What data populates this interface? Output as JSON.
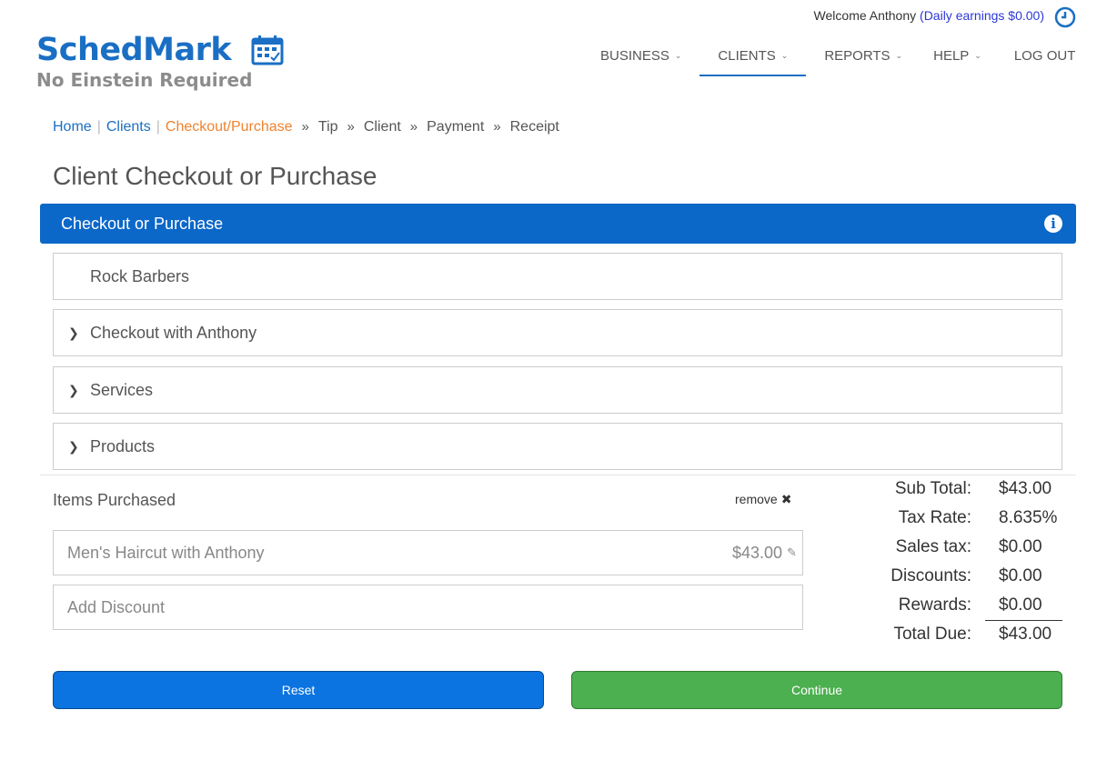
{
  "header": {
    "welcome_text": "Welcome Anthony",
    "earnings_text": "(Daily earnings $0.00)",
    "logo_title": "SchedMark",
    "logo_tagline": "No Einstein Required"
  },
  "nav": {
    "items": [
      {
        "label": "BUSINESS",
        "has_dropdown": true
      },
      {
        "label": "CLIENTS",
        "has_dropdown": true
      },
      {
        "label": "REPORTS",
        "has_dropdown": true
      },
      {
        "label": "HELP",
        "has_dropdown": true
      },
      {
        "label": "LOG OUT",
        "has_dropdown": false
      }
    ],
    "active": "CLIENTS"
  },
  "breadcrumb": {
    "home": "Home",
    "clients": "Clients",
    "current": "Checkout/Purchase",
    "steps": [
      "Tip",
      "Client",
      "Payment",
      "Receipt"
    ]
  },
  "page": {
    "title": "Client Checkout or Purchase",
    "panel_title": "Checkout or Purchase"
  },
  "sections": {
    "business": "Rock Barbers",
    "checkout_with": "Checkout with Anthony",
    "services": "Services",
    "products": "Products"
  },
  "items": {
    "label": "Items Purchased",
    "remove_label": "remove",
    "list": [
      {
        "name": "Men's Haircut with Anthony",
        "price": "$43.00"
      }
    ],
    "discount_placeholder": "Add Discount"
  },
  "totals": {
    "subtotal_label": "Sub Total:",
    "subtotal": "$43.00",
    "tax_rate_label": "Tax Rate:",
    "tax_rate": "8.635%",
    "sales_tax_label": "Sales tax:",
    "sales_tax": "$0.00",
    "discounts_label": "Discounts:",
    "discounts": "$0.00",
    "rewards_label": "Rewards:",
    "rewards": "$0.00",
    "total_label": "Total Due:",
    "total": "$43.00"
  },
  "buttons": {
    "reset": "Reset",
    "continue": "Continue"
  },
  "colors": {
    "brand_blue": "#0b67c8",
    "breadcrumb_current": "#f0822d",
    "continue_green": "#4caf50"
  }
}
